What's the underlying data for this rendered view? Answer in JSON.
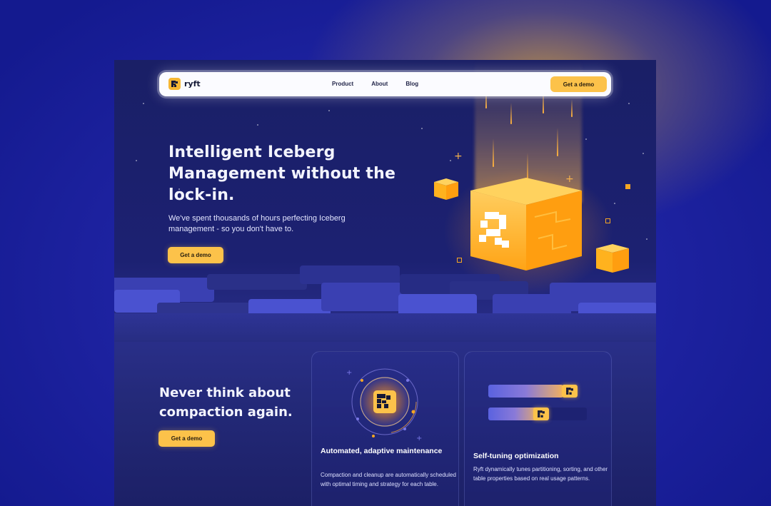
{
  "nav": {
    "brand": "ryft",
    "links": [
      "Product",
      "About",
      "Blog"
    ],
    "cta_label": "Get a demo"
  },
  "hero": {
    "title": "Intelligent Iceberg Management without the lock-in.",
    "subtitle": "We've spent thousands of hours perfecting Iceberg management - so you don't have to.",
    "cta_label": "Get a demo",
    "graphic_icon": "ryft-logo-cube-icon"
  },
  "section": {
    "title": "Never think about compaction again.",
    "cta_label": "Get a demo"
  },
  "cards": [
    {
      "title": "Automated, adaptive maintenance",
      "text": "Compaction and cleanup are automatically scheduled with optimal timing and strategy for each table.",
      "icon": "ryft-orbit-icon"
    },
    {
      "title": "Self-tuning optimization",
      "text": "Ryft dynamically tunes partitioning, sorting, and other table properties based on real usage patterns.",
      "icon": "slider-bars-icon",
      "slider_levels": [
        0.83,
        0.54
      ]
    }
  ],
  "colors": {
    "accent": "#fcc24a",
    "background": "#1c2172",
    "text": "#f3f4ff"
  }
}
